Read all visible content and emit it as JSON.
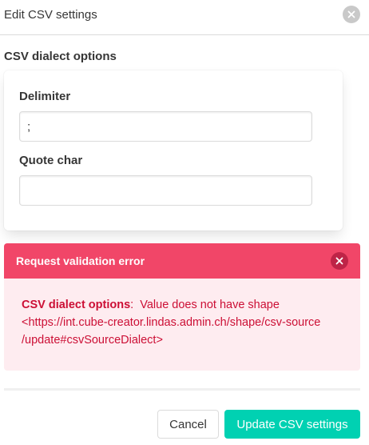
{
  "dialog": {
    "title": "Edit CSV settings",
    "close_icon": "close-icon"
  },
  "form": {
    "section_title": "CSV dialect options",
    "delimiter": {
      "label": "Delimiter",
      "value": ";"
    },
    "quote_char": {
      "label": "Quote char",
      "value": ""
    }
  },
  "error": {
    "title": "Request validation error",
    "close_icon": "close-icon",
    "field": "CSV dialect options",
    "separator": ":",
    "message": "Value does not have shape",
    "shape_line1": "<https://int.cube-creator.lindas.admin.ch/shape/csv-source",
    "shape_line2": "/update#csvSourceDialect>"
  },
  "footer": {
    "cancel_label": "Cancel",
    "update_label": "Update CSV settings"
  },
  "colors": {
    "danger": "#f14668",
    "danger_light": "#feecf0",
    "danger_text": "#cc0f35",
    "primary": "#00d1b2"
  }
}
